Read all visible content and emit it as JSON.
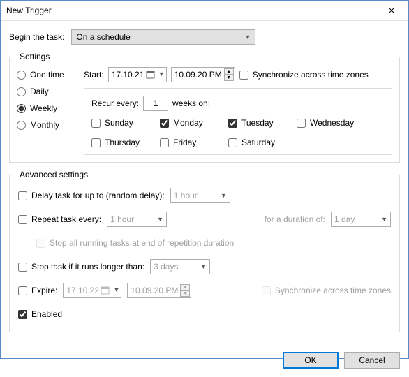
{
  "window": {
    "title": "New Trigger"
  },
  "begin": {
    "label": "Begin the task:",
    "value": "On a schedule"
  },
  "settings": {
    "legend": "Settings",
    "frequency": {
      "one_time": "One time",
      "daily": "Daily",
      "weekly": "Weekly",
      "monthly": "Monthly",
      "selected": "weekly"
    },
    "start": {
      "label": "Start:",
      "date": "17.10.21",
      "time": "10.09.20 PM",
      "sync_label": "Synchronize across time zones",
      "sync_checked": false
    },
    "recur": {
      "label_prefix": "Recur every:",
      "value": "1",
      "label_suffix": "weeks on:",
      "days": {
        "sunday": {
          "label": "Sunday",
          "checked": false
        },
        "monday": {
          "label": "Monday",
          "checked": true
        },
        "tuesday": {
          "label": "Tuesday",
          "checked": true
        },
        "wednesday": {
          "label": "Wednesday",
          "checked": false
        },
        "thursday": {
          "label": "Thursday",
          "checked": false
        },
        "friday": {
          "label": "Friday",
          "checked": false
        },
        "saturday": {
          "label": "Saturday",
          "checked": false
        }
      }
    }
  },
  "advanced": {
    "legend": "Advanced settings",
    "delay": {
      "label": "Delay task for up to (random delay):",
      "value": "1 hour",
      "checked": false
    },
    "repeat": {
      "label": "Repeat task every:",
      "value": "1 hour",
      "checked": false,
      "duration_label": "for a duration of:",
      "duration_value": "1 day"
    },
    "stop_all": {
      "label": "Stop all running tasks at end of repetition duration",
      "checked": false
    },
    "stop_if": {
      "label": "Stop task if it runs longer than:",
      "value": "3 days",
      "checked": false
    },
    "expire": {
      "label": "Expire:",
      "date": "17.10.22",
      "time": "10.09.20 PM",
      "checked": false,
      "sync_label": "Synchronize across time zones",
      "sync_checked": false
    },
    "enabled": {
      "label": "Enabled",
      "checked": true
    }
  },
  "footer": {
    "ok": "OK",
    "cancel": "Cancel"
  }
}
